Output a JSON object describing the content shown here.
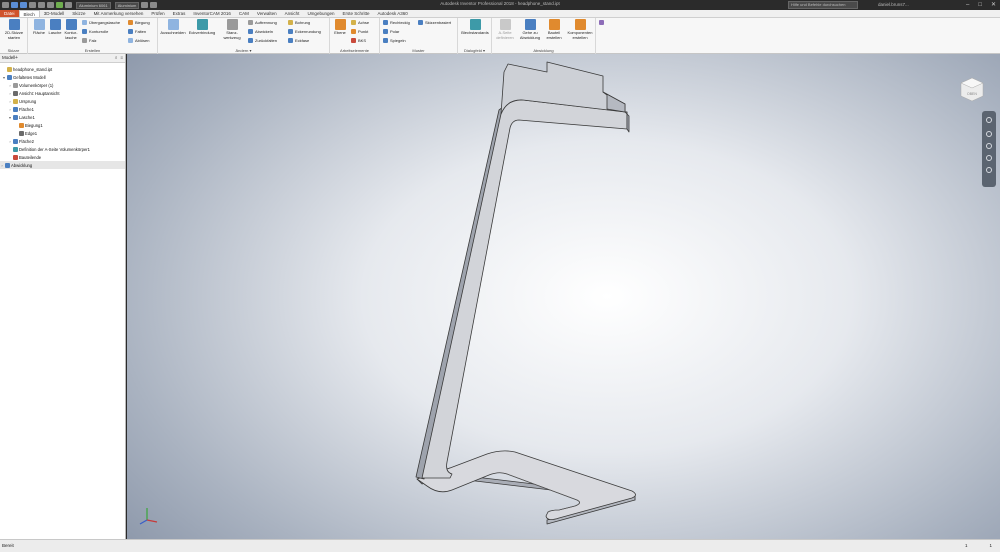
{
  "titlebar": {
    "title": "Autodesk Inventor Professional 2018 - headphone_stand.ipt",
    "material_combo": "Aluminium 6061",
    "appearance_combo": "Aluminium",
    "help_search": "Hilfe und Befehle durchsuchen",
    "user": "daniel.bruns7...",
    "min": "–",
    "max": "□",
    "close": "✕"
  },
  "tabs": [
    {
      "label": "Datei"
    },
    {
      "label": "Blech"
    },
    {
      "label": "3D-Modell"
    },
    {
      "label": "Skizze"
    },
    {
      "label": "Mit Anmerkung versehen"
    },
    {
      "label": "Prüfen"
    },
    {
      "label": "Extras"
    },
    {
      "label": "InventorCAM 2016"
    },
    {
      "label": "CAM"
    },
    {
      "label": "Verwalten"
    },
    {
      "label": "Ansicht"
    },
    {
      "label": "Umgebungen"
    },
    {
      "label": "Erste Schritte"
    },
    {
      "label": "Autodesk A360"
    }
  ],
  "ribbon": {
    "skizze": {
      "label": "Skizze",
      "start_sketch": "2D-Skizze starten"
    },
    "erstellen": {
      "label": "Erstellen",
      "flaeche": "Fläche",
      "lasche": "Lasche",
      "konturlasche": "Kontur-lasche",
      "uebergangslasche": "Übergangslasche",
      "konturrolle": "Konturrolle",
      "falz": "Falz",
      "biegung": "Biegung",
      "falten": "Falten",
      "abloesen": "Ablösen"
    },
    "aendern": {
      "label": "Ändern",
      "ausschneiden": "Ausschneiden",
      "eckverbindung": "Eckverbindung",
      "stanzwerkzeug": "Stanz-werkzeug",
      "aufrennung": "Auftrennung",
      "abwickeln": "Abwickeln",
      "zurueckfalten": "Zurückfalten",
      "bohrung": "Bohrung",
      "eckenrundung": "Eckenrundung",
      "eckfase": "Eckfase"
    },
    "arbeitselemente": {
      "label": "Arbeitselemente",
      "ebene": "Ebene",
      "achse": "Achse",
      "punkt": "Punkt",
      "bks": "BKS"
    },
    "muster": {
      "label": "Muster",
      "rechteckig": "Rechteckig",
      "polar": "Polar",
      "spiegeln": "Spiegeln",
      "skizzenbasiert": "Skizzenbasiert"
    },
    "dialogfeld": {
      "label": "Dialogfeld",
      "blechstandards": "Blechstandards"
    },
    "abwicklung": {
      "label": "Abwicklung",
      "aseite": "A-Seite definieren",
      "gehezu": "Gehe zu Abwicklung",
      "bauteil": "Bauteil erstellen",
      "komponenten": "Komponenten erstellen"
    }
  },
  "browser": {
    "tab_label": "Modell",
    "plus": "+",
    "icon_search": "⌕",
    "icon_menu": "≡",
    "items": [
      {
        "label": "headphone_stand.ipt",
        "level": 0,
        "toggle": "",
        "icon": "part-icon"
      },
      {
        "label": "Gefaltetes Modell",
        "level": 0,
        "toggle": "▾",
        "icon": "folded-model-icon"
      },
      {
        "label": "Volumenkörper (1)",
        "level": 1,
        "toggle": "›",
        "icon": "solid-bodies-icon"
      },
      {
        "label": "Ansicht: Hauptansicht",
        "level": 1,
        "toggle": "›",
        "icon": "view-icon"
      },
      {
        "label": "Ursprung",
        "level": 1,
        "toggle": "›",
        "icon": "origin-folder-icon"
      },
      {
        "label": "Fläche1",
        "level": 1,
        "toggle": "›",
        "icon": "face-feature-icon"
      },
      {
        "label": "Lasche1",
        "level": 1,
        "toggle": "▾",
        "icon": "flange-feature-icon"
      },
      {
        "label": "Biegung1",
        "level": 2,
        "toggle": "",
        "icon": "bend-icon"
      },
      {
        "label": "Edge1",
        "level": 2,
        "toggle": "",
        "icon": "edge-icon"
      },
      {
        "label": "Fläche2",
        "level": 1,
        "toggle": "›",
        "icon": "face-feature-icon"
      },
      {
        "label": "Definition der A-Seite Volumenkörper1",
        "level": 1,
        "toggle": "",
        "icon": "a-side-icon"
      },
      {
        "label": "Bauteilende",
        "level": 1,
        "toggle": "",
        "icon": "end-of-part-icon"
      },
      {
        "label": "Abwicklung",
        "level": 0,
        "toggle": "›",
        "icon": "flat-pattern-icon"
      }
    ]
  },
  "viewcube": {
    "face_label": "OBEN"
  },
  "status": {
    "text": "Bereit",
    "val1": "1",
    "val2": "1"
  },
  "colors": {
    "file_tab": "#d0532c",
    "part_face": "#d6d7dc",
    "part_edge": "#3a3a3a"
  }
}
